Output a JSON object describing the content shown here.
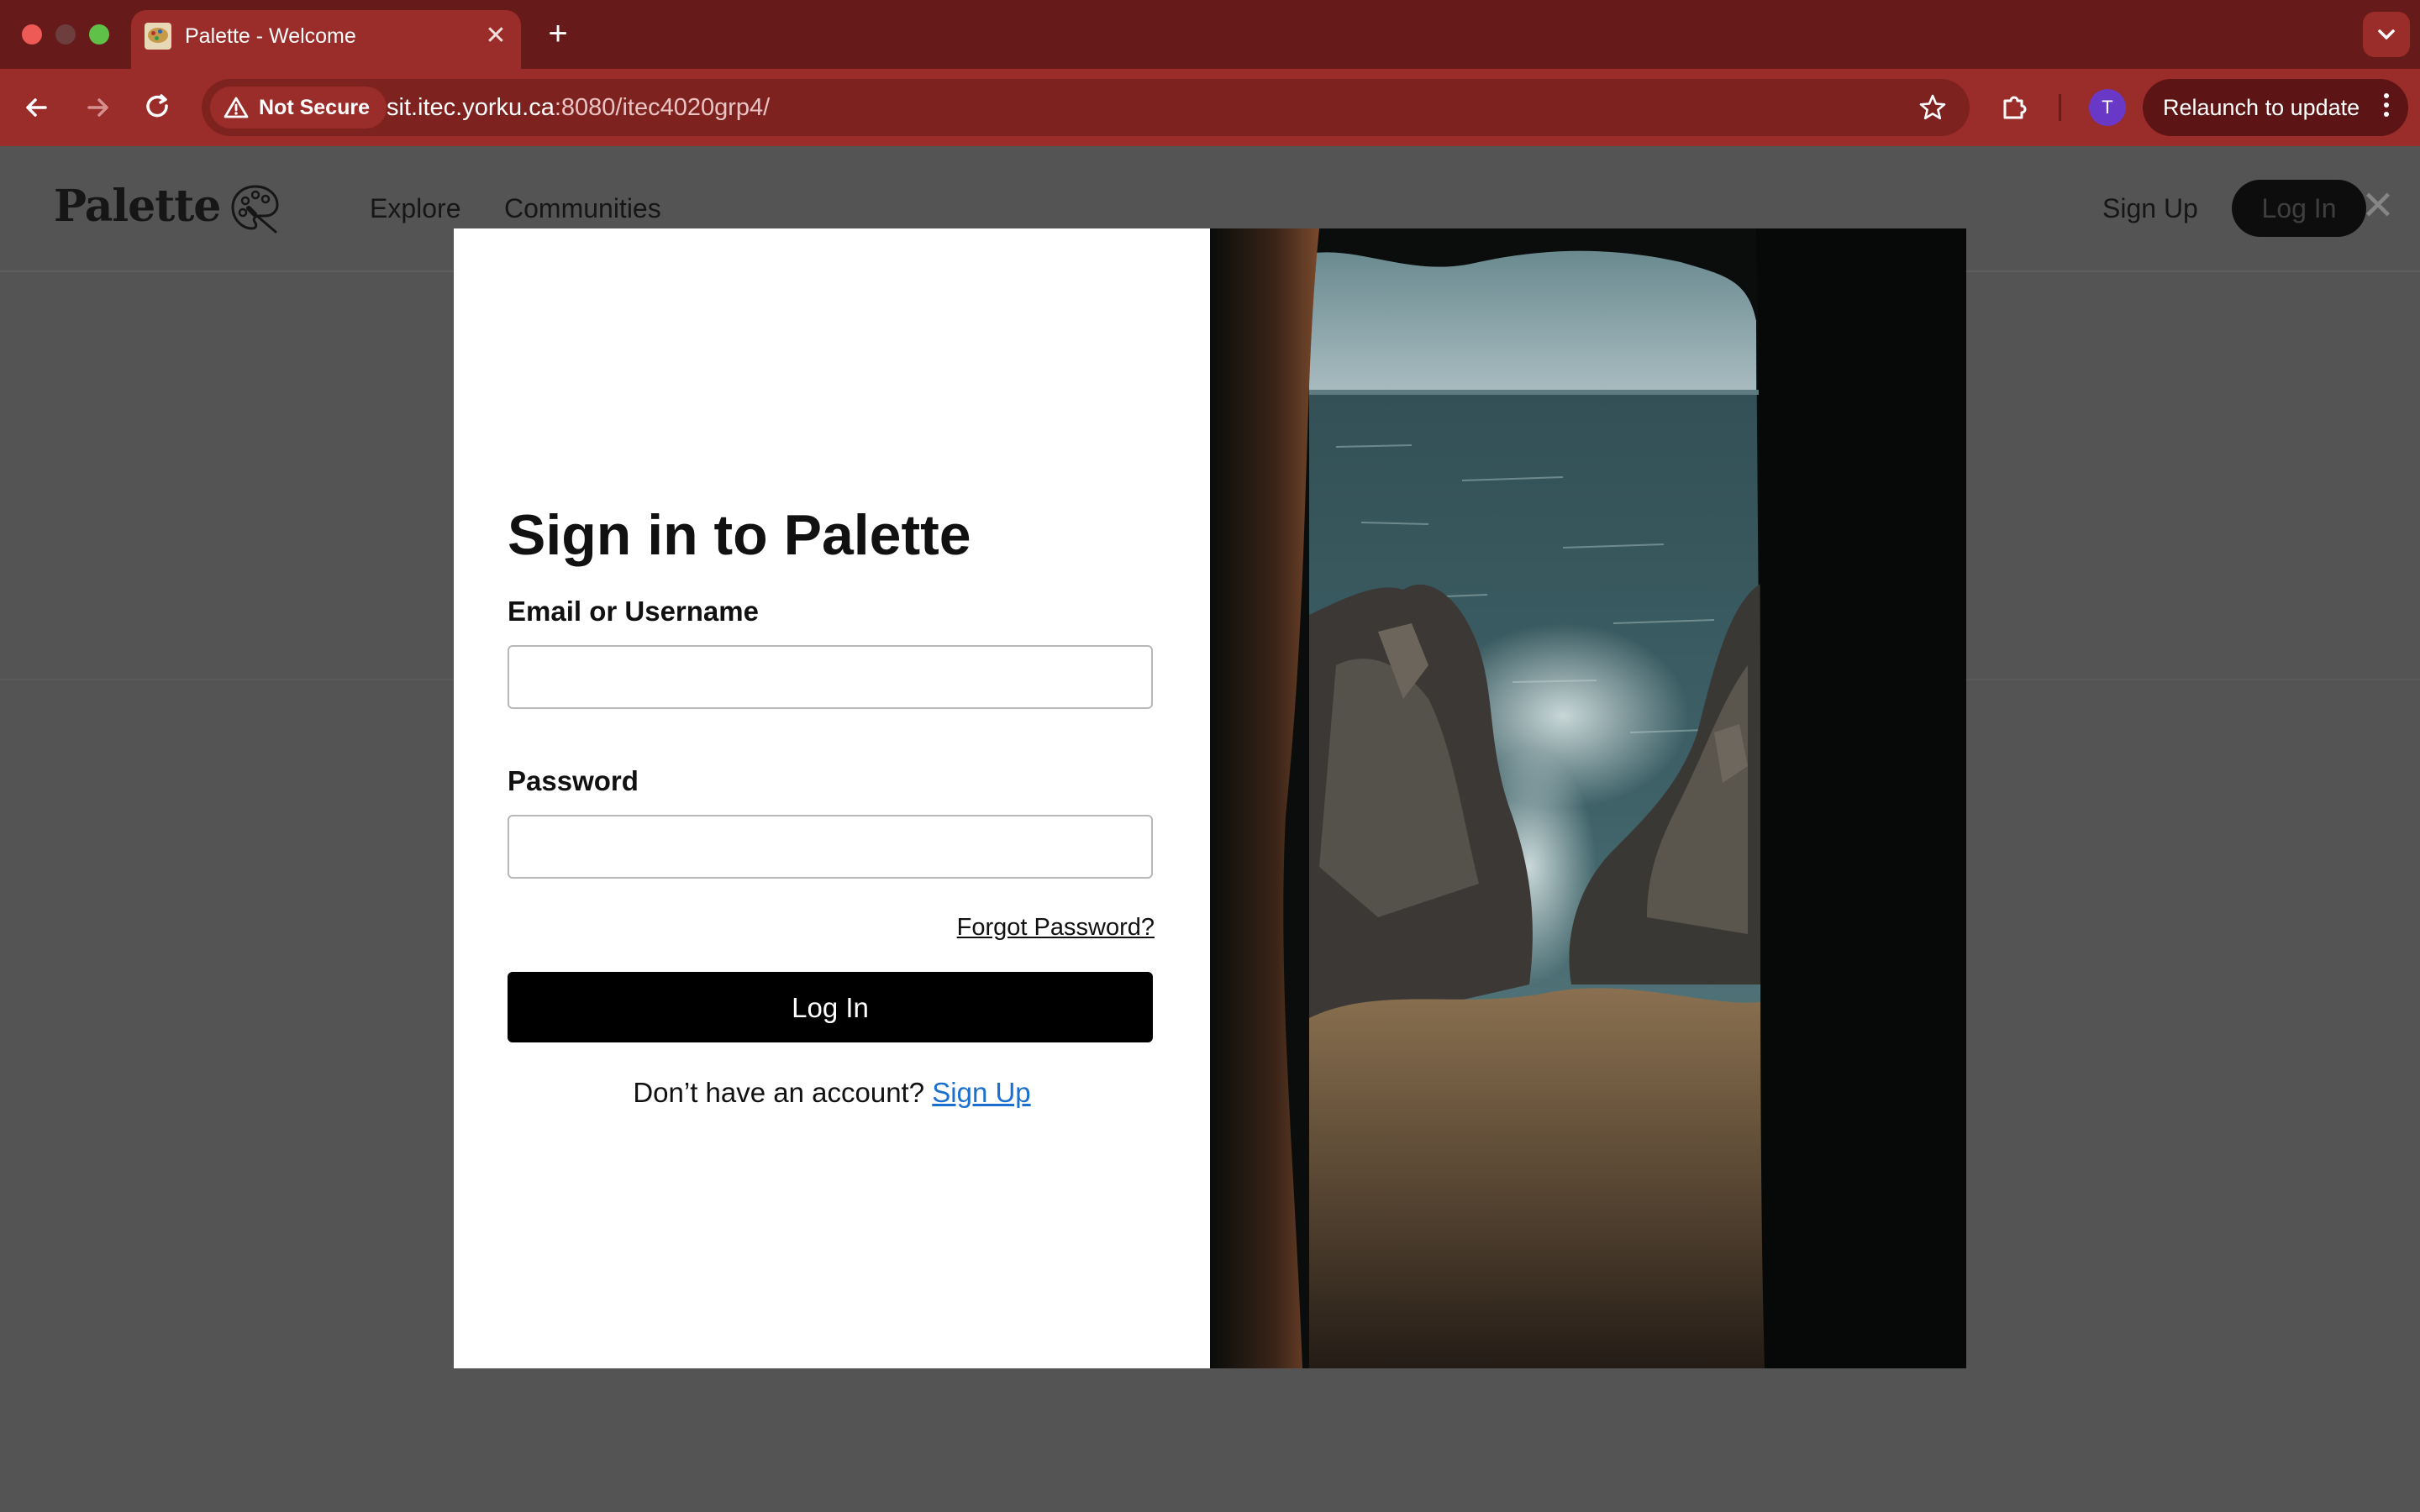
{
  "browser": {
    "tab_title": "Palette - Welcome",
    "security_label": "Not Secure",
    "url_host": "sit.itec.yorku.ca",
    "url_rest": ":8080/itec4020grp4/",
    "profile_initial": "T",
    "relaunch_label": "Relaunch to update"
  },
  "site": {
    "logo_text": "Palette",
    "nav": {
      "explore": "Explore",
      "communities": "Communities",
      "sign_up": "Sign Up",
      "log_in": "Log In"
    }
  },
  "login_modal": {
    "title": "Sign in to Palette",
    "email_label": "Email or Username",
    "email_value": "",
    "password_label": "Password",
    "password_value": "",
    "forgot_password": "Forgot Password?",
    "submit_label": "Log In",
    "no_account_text": "Don’t have an account? ",
    "sign_up_link": "Sign Up"
  },
  "colors": {
    "browser_frame": "#661a1a",
    "browser_toolbar": "#9a2c29",
    "page_overlay": "#545454",
    "primary_button": "#000000",
    "link": "#1a6fd0"
  }
}
